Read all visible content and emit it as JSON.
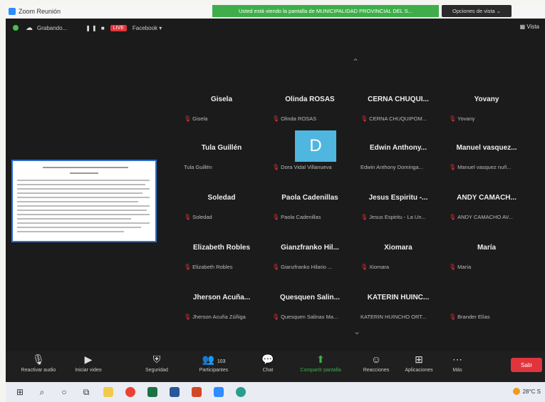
{
  "window": {
    "title": "Zoom Reunión"
  },
  "banner": {
    "text": "Usted está viendo la pantalla de MUNICIPALIDAD PROVINCIAL DEL S...",
    "view_options": "Opciones de vista ⌄"
  },
  "topbar": {
    "recording": "Grabando...",
    "live": "LIVE",
    "stream": "Facebook ▾",
    "view": "Vista"
  },
  "participants": [
    {
      "name": "Gisela",
      "label": "Gisela",
      "muted": true
    },
    {
      "name": "Olinda ROSAS",
      "label": "Olinda ROSAS",
      "muted": true
    },
    {
      "name": "CERNA CHUQUI...",
      "label": "CERNA CHUQUIPOM...",
      "muted": true
    },
    {
      "name": "Yovany",
      "label": "Yovany",
      "muted": true
    },
    {
      "name": "Tula Guillén",
      "label": "Tula Guillén",
      "muted": false
    },
    {
      "name": "",
      "label": "Dora Vidal Villanueva",
      "muted": true
    },
    {
      "name": "Edwin Anthony...",
      "label": "Edwin Anthony Dominga...",
      "muted": false
    },
    {
      "name": "Manuel vasquez...",
      "label": "Manuel vasquez nuñ...",
      "muted": true
    },
    {
      "name": "Soledad",
      "label": "Soledad",
      "muted": true
    },
    {
      "name": "Paola Cadenillas",
      "label": "Paola Cadenillas",
      "muted": true
    },
    {
      "name": "Jesus Espiritu -...",
      "label": "Jesus Espiritu - La Un...",
      "muted": true
    },
    {
      "name": "ANDY CAMACH...",
      "label": "ANDY CAMACHO AV...",
      "muted": true
    },
    {
      "name": "Elizabeth Robles",
      "label": "Elizabeth Robles",
      "muted": true
    },
    {
      "name": "Gianzfranko Hil...",
      "label": "Gianzfranko Hilario ...",
      "muted": true
    },
    {
      "name": "Xiomara",
      "label": "Xiomara",
      "muted": true
    },
    {
      "name": "María",
      "label": "María",
      "muted": true
    },
    {
      "name": "Jherson Acuña...",
      "label": "Jherson Acuña Zúñiga",
      "muted": true
    },
    {
      "name": "Quesquen Salin...",
      "label": "Quesquen Salinas Ma...",
      "muted": true
    },
    {
      "name": "KATERIN HUINC...",
      "label": "KATERIN HUINCHO ORT...",
      "muted": false
    },
    {
      "name": "",
      "label": "Brander Elías",
      "muted": true
    }
  ],
  "avatar_letter": "D",
  "toolbar": {
    "audio": "Reactivar audio",
    "video": "Iniciar video",
    "security": "Seguridad",
    "participants": "Participantes",
    "participants_count": "103",
    "chat": "Chat",
    "share": "Compartir pantalla",
    "reactions": "Reacciones",
    "apps": "Aplicaciones",
    "more": "Más",
    "leave": "Salir"
  },
  "taskbar": {
    "temperature": "28°C S"
  }
}
